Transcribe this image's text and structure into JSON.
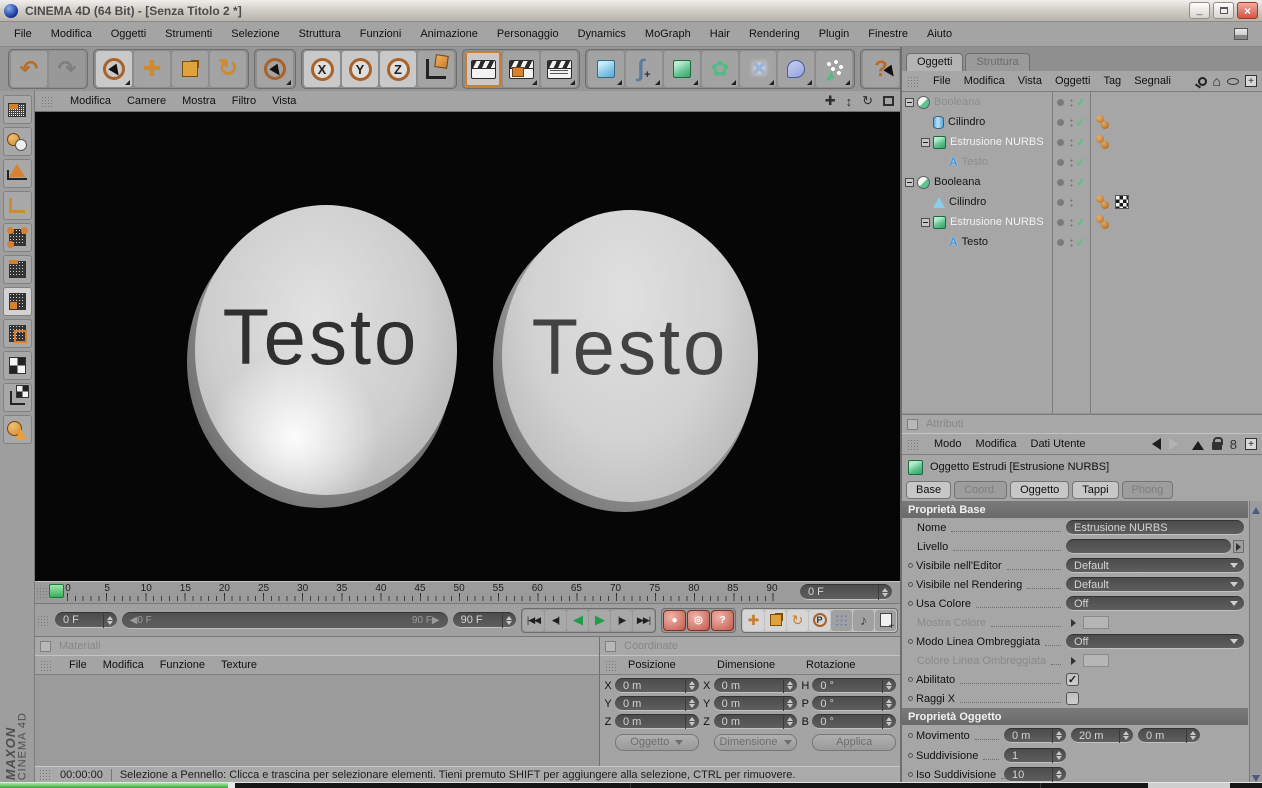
{
  "colors": {
    "accent_orange": "#c87f2e",
    "selection_green": "#58c878",
    "record_red": "#c25a4c",
    "viewport_bg": "#060606",
    "boolean_green": "#5cc28e",
    "cylinder_blue": "#8cccec"
  },
  "window": {
    "title": "CINEMA 4D (64 Bit) - [Senza Titolo 2 *]",
    "controls": [
      "minimize",
      "restore",
      "close"
    ]
  },
  "menubar": {
    "items": [
      "File",
      "Modifica",
      "Oggetti",
      "Strumenti",
      "Selezione",
      "Struttura",
      "Funzioni",
      "Animazione",
      "Personaggio",
      "Dynamics",
      "MoGraph",
      "Hair",
      "Rendering",
      "Plugin",
      "Finestre",
      "Aiuto"
    ]
  },
  "toolbar": {
    "icons": [
      "undo",
      "redo",
      "live-selection",
      "move",
      "scale",
      "rotate",
      "selection",
      "x-axis-lock",
      "y-axis-lock",
      "z-axis-lock",
      "coordinate-system",
      "render-view",
      "render-settings",
      "render-picture-viewer",
      "add-primitive-cube",
      "add-spline",
      "add-nurbs",
      "add-modeling-object",
      "add-deformer",
      "add-environment",
      "add-particles",
      "help",
      "command-manager",
      "content-browser"
    ],
    "axis_labels": {
      "x": "X",
      "y": "Y",
      "z": "Z"
    }
  },
  "left_toolbar": {
    "icons": [
      "make-editable",
      "model-mode",
      "object-mode",
      "axis-mode",
      "points-mode",
      "edges-mode",
      "polygons-mode",
      "uv-mode",
      "texture-mode",
      "texture-axis-mode",
      "selection-filter"
    ],
    "active": "polygons-mode"
  },
  "viewport": {
    "menu": [
      "Modifica",
      "Camere",
      "Mostra",
      "Filtro",
      "Vista"
    ],
    "nav_icons": [
      "pan",
      "zoom",
      "rotate",
      "maximize"
    ],
    "objects": {
      "left_button_text": "Testo",
      "right_button_text": "Testo"
    }
  },
  "timeline": {
    "ticks": [
      "0",
      "5",
      "10",
      "15",
      "20",
      "25",
      "30",
      "35",
      "40",
      "45",
      "50",
      "55",
      "60",
      "65",
      "70",
      "75",
      "80",
      "85",
      "90"
    ],
    "frame_field": "0 F",
    "current_frame_field": "0 F",
    "range_start": "0 F",
    "range_end": "90 F",
    "end_frame_field": "90 F",
    "transport_icons": [
      "go-start",
      "previous-frame",
      "play-backward",
      "play-forward",
      "next-frame",
      "go-end"
    ],
    "record_icons": [
      "record-keyframe",
      "autokey",
      "record-options"
    ],
    "key_toggle_icons": [
      "key-position",
      "key-scale",
      "key-rotation",
      "key-parameter",
      "key-pla",
      "sound",
      "keyframe-selection"
    ]
  },
  "materials": {
    "title": "Materiali",
    "menu": [
      "File",
      "Modifica",
      "Funzione",
      "Texture"
    ]
  },
  "coordinates": {
    "title": "Coordinate",
    "groups": [
      {
        "header": "Posizione",
        "rows": [
          [
            "X",
            "0 m"
          ],
          [
            "Y",
            "0 m"
          ],
          [
            "Z",
            "0 m"
          ]
        ]
      },
      {
        "header": "Dimensione",
        "rows": [
          [
            "X",
            "0 m"
          ],
          [
            "Y",
            "0 m"
          ],
          [
            "Z",
            "0 m"
          ]
        ]
      },
      {
        "header": "Rotazione",
        "rows": [
          [
            "H",
            "0 °"
          ],
          [
            "P",
            "0 °"
          ],
          [
            "B",
            "0 °"
          ]
        ]
      }
    ],
    "footer": {
      "mode": "Oggetto",
      "size_mode": "Dimensione",
      "apply": "Applica"
    }
  },
  "statusbar": {
    "time": "00:00:00",
    "message": "Selezione a Pennello: Clicca e trascina per selezionare elementi. Tieni premuto SHIFT per aggiungere alla selezione, CTRL per rimuovere."
  },
  "branding": {
    "maxon": "MAXON",
    "product": "CINEMA 4D"
  },
  "object_manager": {
    "tabs": [
      {
        "label": "Oggetti",
        "active": true
      },
      {
        "label": "Struttura",
        "active": false
      }
    ],
    "menu": [
      "File",
      "Modifica",
      "Vista",
      "Oggetti",
      "Tag",
      "Segnali"
    ],
    "menu_icons": [
      "search",
      "home",
      "eye",
      "add-panel"
    ],
    "tree": [
      {
        "label": "Booleana",
        "icon": "boolean",
        "dimmed": true,
        "selected": false,
        "level": 0,
        "expander": true,
        "check": true,
        "tags": []
      },
      {
        "label": "Cilindro",
        "icon": "cylinder",
        "dimmed": false,
        "selected": false,
        "level": 1,
        "expander": false,
        "check": true,
        "tags": [
          "material"
        ]
      },
      {
        "label": "Estrusione NURBS",
        "icon": "nurbs",
        "dimmed": false,
        "selected": true,
        "level": 1,
        "expander": true,
        "check": true,
        "tags": [
          "material"
        ]
      },
      {
        "label": "Testo",
        "icon": "text",
        "dimmed": true,
        "selected": false,
        "level": 2,
        "expander": false,
        "check": true,
        "tags": []
      },
      {
        "label": "Booleana",
        "icon": "boolean",
        "dimmed": false,
        "selected": false,
        "level": 0,
        "expander": true,
        "check": true,
        "tags": []
      },
      {
        "label": "Cilindro",
        "icon": "cone",
        "dimmed": false,
        "selected": false,
        "level": 1,
        "expander": false,
        "check": false,
        "tags": [
          "material",
          "checker"
        ]
      },
      {
        "label": "Estrusione NURBS",
        "icon": "nurbs",
        "dimmed": false,
        "selected": true,
        "level": 1,
        "expander": true,
        "check": true,
        "tags": [
          "material"
        ]
      },
      {
        "label": "Testo",
        "icon": "text",
        "dimmed": false,
        "selected": false,
        "level": 2,
        "expander": false,
        "check": true,
        "tags": []
      }
    ]
  },
  "attributes": {
    "panel_title": "Attributi",
    "menu": [
      "Modo",
      "Modifica",
      "Dati Utente"
    ],
    "menu_icons": [
      "history-back",
      "history-forward",
      "parent-up",
      "lock",
      "link",
      "add-panel"
    ],
    "object_header": "Oggetto Estrudi [Estrusione NURBS]",
    "tabs": [
      {
        "label": "Base",
        "state": "active"
      },
      {
        "label": "Coord.",
        "state": "dimmed"
      },
      {
        "label": "Oggetto",
        "state": "active"
      },
      {
        "label": "Tappi",
        "state": "active"
      },
      {
        "label": "Phong",
        "state": "dimmed"
      }
    ],
    "base_section": "Proprietà Base",
    "object_section": "Proprietà Oggetto",
    "rows": {
      "nome": {
        "label": "Nome",
        "value": "Estrusione NURBS"
      },
      "livello": {
        "label": "Livello",
        "value": ""
      },
      "visibile_editor": {
        "label": "Visibile nell'Editor",
        "value": "Default"
      },
      "visibile_rendering": {
        "label": "Visibile nel Rendering",
        "value": "Default"
      },
      "usa_colore": {
        "label": "Usa Colore",
        "value": "Off"
      },
      "mostra_colore": {
        "label": "Mostra Colore"
      },
      "modo_linea_ombreggiata": {
        "label": "Modo Linea Ombreggiata",
        "value": "Off"
      },
      "colore_linea_ombreggiata": {
        "label": "Colore Linea Ombreggiata"
      },
      "abilitato": {
        "label": "Abilitato",
        "checked": true
      },
      "raggi_x": {
        "label": "Raggi X",
        "checked": false
      },
      "movimento": {
        "label": "Movimento",
        "values": [
          "0 m",
          "20 m",
          "0 m"
        ]
      },
      "suddivisione": {
        "label": "Suddivisione",
        "value": "1"
      },
      "iso_suddivisione": {
        "label": "Iso Suddivisione",
        "value": "10"
      }
    }
  }
}
